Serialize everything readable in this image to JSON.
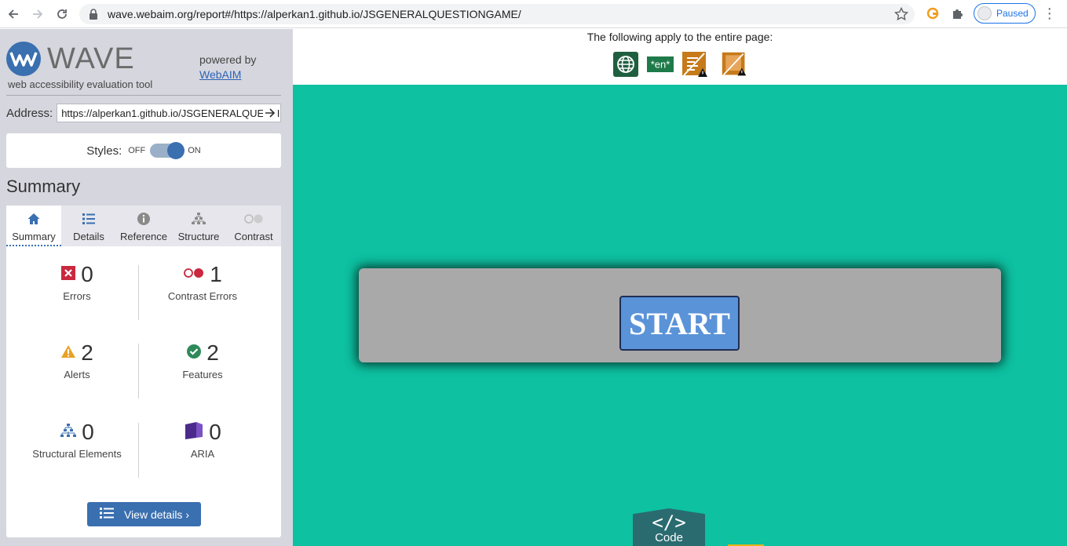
{
  "browser": {
    "url": "wave.webaim.org/report#/https://alperkan1.github.io/JSGENERALQUESTIONGAME/",
    "profile_status": "Paused"
  },
  "wave": {
    "brand": "WAVE",
    "tagline": "web accessibility evaluation tool",
    "powered_by": "powered by",
    "webaim_link": "WebAIM",
    "address_label": "Address:",
    "address_value": "https://alperkan1.github.io/JSGENERALQUESTIONGAME/",
    "styles_label": "Styles:",
    "styles_off": "OFF",
    "styles_on": "ON",
    "summary_title": "Summary",
    "tabs": [
      {
        "label": "Summary",
        "icon": "home-icon"
      },
      {
        "label": "Details",
        "icon": "list-icon"
      },
      {
        "label": "Reference",
        "icon": "info-icon"
      },
      {
        "label": "Structure",
        "icon": "structure-icon"
      },
      {
        "label": "Contrast",
        "icon": "contrast-icon"
      }
    ],
    "stats": {
      "errors": {
        "count": "0",
        "label": "Errors"
      },
      "contrast_errors": {
        "count": "1",
        "label": "Contrast Errors"
      },
      "alerts": {
        "count": "2",
        "label": "Alerts"
      },
      "features": {
        "count": "2",
        "label": "Features"
      },
      "structural": {
        "count": "0",
        "label": "Structural Elements"
      },
      "aria": {
        "count": "0",
        "label": "ARIA"
      }
    },
    "view_details": "View details ›"
  },
  "page_panel": {
    "heading": "The following apply to the entire page:",
    "lang_badge": "*en*"
  },
  "page": {
    "start_label": "START",
    "code_label": "Code",
    "code_glyph": "</>"
  },
  "colors": {
    "page_bg": "#0dc1a1",
    "wave_blue": "#3a6fb0",
    "start_button": "#5a93d8"
  }
}
